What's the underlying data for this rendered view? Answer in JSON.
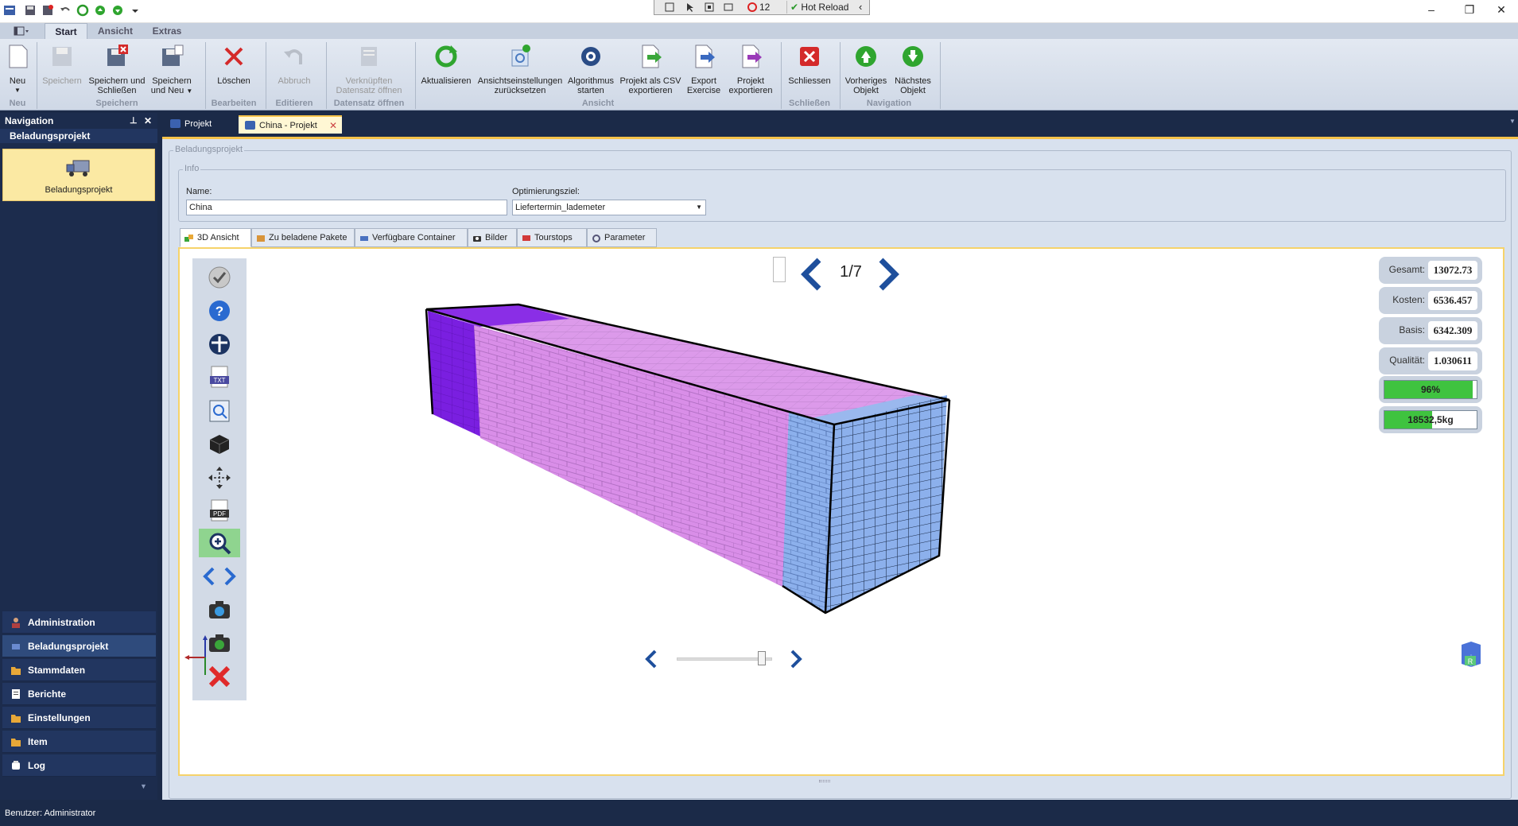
{
  "window": {
    "debug_count": "12",
    "hot_reload": "Hot Reload"
  },
  "ribbon": {
    "tabs": [
      "Start",
      "Ansicht",
      "Extras"
    ],
    "buttons": {
      "neu": "Neu",
      "speichern": "Speichern",
      "speichern_schliessen_1": "Speichern und",
      "speichern_schliessen_2": "Schließen",
      "speichern_neu_1": "Speichern",
      "speichern_neu_2": "und Neu",
      "loeschen": "Löschen",
      "abbruch": "Abbruch",
      "verknuepfen_1": "Verknüpften",
      "verknuepfen_2": "Datensatz öffnen",
      "aktualisieren": "Aktualisieren",
      "ansicht_reset_1": "Ansichtseinstellungen",
      "ansicht_reset_2": "zurücksetzen",
      "algo_1": "Algorithmus",
      "algo_2": "starten",
      "csv_1": "Projekt als CSV",
      "csv_2": "exportieren",
      "exercise_1": "Export",
      "exercise_2": "Exercise",
      "projekt_export_1": "Projekt",
      "projekt_export_2": "exportieren",
      "schliessen": "Schliessen",
      "vorheriges_1": "Vorheriges",
      "vorheriges_2": "Objekt",
      "naechstes_1": "Nächstes",
      "naechstes_2": "Objekt"
    },
    "groups": {
      "neu": "Neu",
      "speichern": "Speichern",
      "bearbeiten": "Bearbeiten",
      "editieren": "Editieren",
      "datensatz": "Datensatz öffnen",
      "ansicht": "Ansicht",
      "schliessen": "Schließen",
      "navigation": "Navigation"
    }
  },
  "nav": {
    "title": "Navigation",
    "section": "Beladungsprojekt",
    "tile": "Beladungsprojekt",
    "items": [
      "Administration",
      "Beladungsprojekt",
      "Stammdaten",
      "Berichte",
      "Einstellungen",
      "Item",
      "Log"
    ]
  },
  "doc_tabs": [
    "Projekt",
    "China - Projekt"
  ],
  "form": {
    "group": "Beladungsprojekt",
    "info": "Info",
    "name_label": "Name:",
    "name_value": "China",
    "opt_label": "Optimierungsziel:",
    "opt_value": "Liefertermin_lademeter"
  },
  "inner_tabs": [
    "3D Ansicht",
    "Zu beladene Pakete",
    "Verfügbare Container",
    "Bilder",
    "Tourstops",
    "Parameter"
  ],
  "viewer": {
    "page": "1/7",
    "stats": [
      {
        "label": "Gesamt:",
        "value": "13072.73"
      },
      {
        "label": "Kosten:",
        "value": "6536.457"
      },
      {
        "label": "Basis:",
        "value": "6342.309"
      },
      {
        "label": "Qualität:",
        "value": "1.030611"
      }
    ],
    "fill_percent": "96%",
    "fill_fraction": 0.96,
    "weight": "18532,5kg",
    "weight_fraction": 0.52,
    "slider_fraction": 0.92
  },
  "status": "Benutzer: Administrator",
  "colors": {
    "accent": "#f6c34a",
    "nav": "#1c2c4d",
    "purple": "#7a1fe0",
    "lilac": "#d98ee8",
    "blue": "#8cb0ec"
  }
}
